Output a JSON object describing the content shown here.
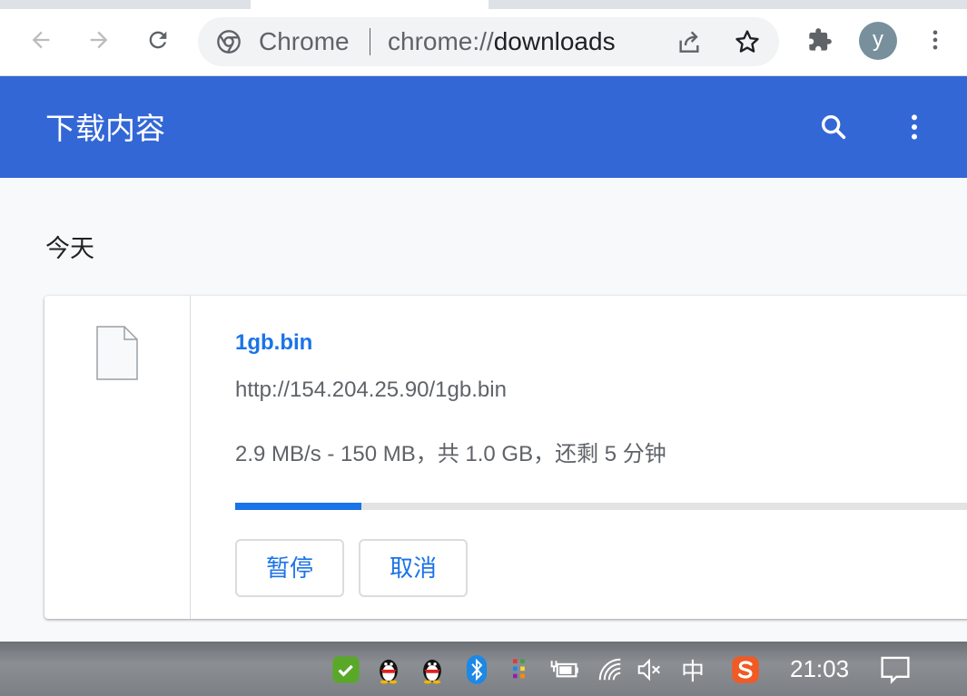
{
  "browser": {
    "app_label": "Chrome",
    "url_scheme": "chrome://",
    "url_host": "downloads",
    "avatar_letter": "y"
  },
  "page": {
    "title": "下载内容",
    "section_date": "今天"
  },
  "download": {
    "file_name": "1gb.bin",
    "url": "http://154.204.25.90/1gb.bin",
    "status": "2.9 MB/s - 150 MB，共 1.0 GB，还剩 5 分钟",
    "progress_percent": 17,
    "pause_label": "暂停",
    "cancel_label": "取消"
  },
  "taskbar": {
    "time": "21:03",
    "ime_label": "中"
  },
  "colors": {
    "header_blue": "#3367d6",
    "link_blue": "#1a73e8"
  },
  "icons": {
    "back": "back-arrow-icon",
    "forward": "forward-arrow-icon",
    "reload": "reload-icon",
    "site_info": "chrome-logo-icon",
    "share": "share-icon",
    "bookmark": "star-icon",
    "extensions": "puzzle-icon",
    "menu": "kebab-menu-icon",
    "search": "search-icon",
    "file": "file-icon"
  }
}
